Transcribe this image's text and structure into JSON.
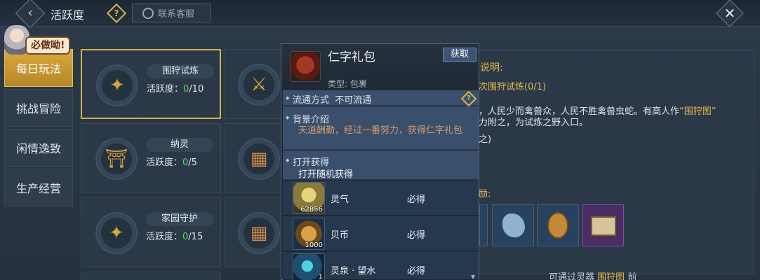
{
  "topbar": {
    "title": "活跃度",
    "help_glyph": "?",
    "service_label": "联系客服",
    "close_glyph": "✕",
    "back_glyph": "‹"
  },
  "mascot": {
    "bubble": "必做呦!"
  },
  "sidebar": {
    "items": [
      {
        "label": "每日玩法",
        "active": true
      },
      {
        "label": "挑战冒险",
        "active": false
      },
      {
        "label": "闲情逸致",
        "active": false
      },
      {
        "label": "生产经营",
        "active": false
      }
    ]
  },
  "activities": [
    {
      "name": "围狩试炼",
      "label": "活跃度：",
      "current": "0",
      "total": "/10",
      "icon": "mystic-beast-icon"
    },
    {
      "name": "纳灵",
      "label": "活跃度：",
      "current": "0",
      "total": "/5",
      "icon": "gate-icon"
    },
    {
      "name": "家园守护",
      "label": "活跃度：",
      "current": "0",
      "total": "/15",
      "icon": "mystic-beast-icon"
    }
  ],
  "description": {
    "heading_tail": "说明:",
    "quest_line": "次围狩试炼(0/1)",
    "story_1a": "，人民少而禽兽众，人民不胜禽兽虫蛇。有高人作",
    "story_1b": "“围狩图”",
    "story_2": "力附之，为试炼之野入口。",
    "story_3": "之)",
    "reward_heading_tail": "励:",
    "footer_text": "可通过灵器",
    "footer_highlight": "围狩图",
    "footer_tail": "前"
  },
  "popup": {
    "item_name": "仁字礼包",
    "item_type": "类型: 包裹",
    "get_label": "获取",
    "flow_label": "流通方式",
    "flow_value": "不可流通",
    "bg_title": "背景介绍",
    "bg_text": "天道酬勤，经过一番努力，获得仁字礼包",
    "open_title": "打开获得",
    "open_text": "打开随机获得",
    "rows": [
      {
        "name": "灵气",
        "tag": "必得",
        "count": "62856",
        "color": "#8a7a3a"
      },
      {
        "name": "贝币",
        "tag": "必得",
        "count": "1000",
        "color": "#6d4a1e"
      },
      {
        "name": "灵泉 · 望水",
        "tag": "必得",
        "count": "1",
        "color": "#1f4e6e"
      }
    ]
  }
}
